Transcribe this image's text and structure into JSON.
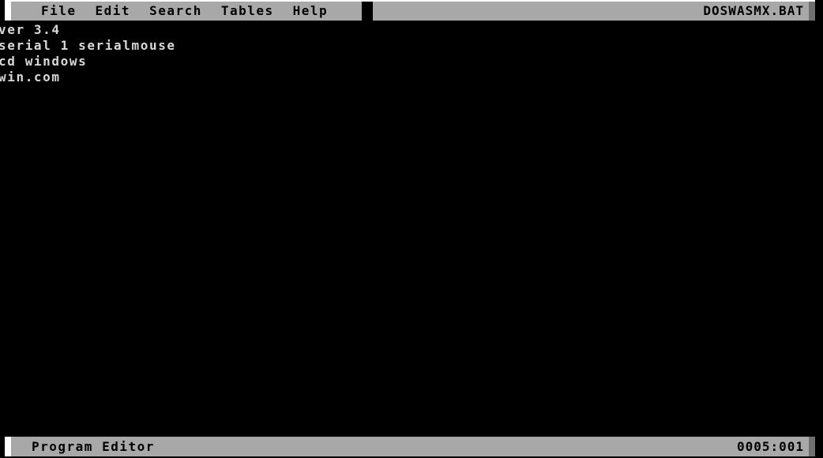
{
  "window": {
    "title": "DOSWASMX.BAT",
    "colors": {
      "bar_background": "#a8a8a8",
      "bar_shadow": "#707070",
      "bar_highlight": "#ffffff",
      "screen_background": "#000000",
      "editor_text": "#d8d8d8",
      "bar_text": "#000000"
    }
  },
  "menubar": {
    "items": [
      {
        "label": "File"
      },
      {
        "label": "Edit"
      },
      {
        "label": "Search"
      },
      {
        "label": "Tables"
      },
      {
        "label": "Help"
      }
    ]
  },
  "editor": {
    "lines": [
      "ver 3.4",
      "serial 1 serialmouse",
      "cd windows",
      "win.com"
    ]
  },
  "statusbar": {
    "mode": "Program Editor",
    "position": "0005:001"
  }
}
